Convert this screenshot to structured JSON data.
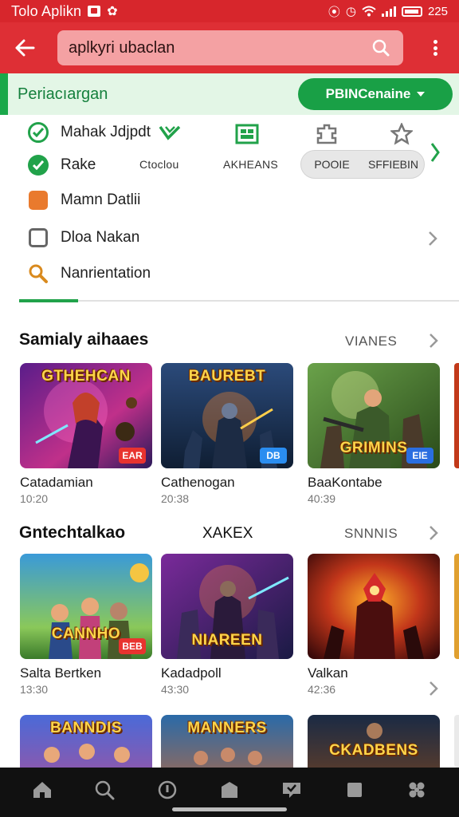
{
  "status_bar": {
    "app_name": "Tolo Aplikn",
    "time": "225"
  },
  "app_bar": {
    "search_value": "aplkyri ubaclan"
  },
  "filter_bar": {
    "title": "Periacıargan",
    "button_label": "PBINCenaine"
  },
  "options": [
    {
      "label": "Mahak Jdjpdt",
      "icon": "check-ring-icon"
    },
    {
      "label": "Rake",
      "icon": "check-circle-icon"
    },
    {
      "label": "Mamn Datlii",
      "icon": "orange-square-icon"
    },
    {
      "label": "Dloa Nakan",
      "icon": "outline-square-icon"
    },
    {
      "label": "Nanrientation",
      "icon": "magnifier-icon"
    }
  ],
  "categories": [
    {
      "label": "Ctoclou",
      "icon": "chevron-check-icon"
    },
    {
      "label": "AKHEANS",
      "icon": "grid-icon"
    },
    {
      "label": "",
      "icon": "puzzle-icon"
    },
    {
      "label": "",
      "icon": "star-icon"
    }
  ],
  "chips": [
    "POOIE",
    "SFFIEBIN"
  ],
  "sections": [
    {
      "title": "Samialy aihaaes",
      "link": "VIANES",
      "middle": "",
      "items": [
        {
          "art_title": "GTHEHCAN",
          "badge": "EAR",
          "badge_color": "#e8332f",
          "name": "Catadamian",
          "time": "10:20"
        },
        {
          "art_title": "BAUREBT",
          "badge": "DB",
          "badge_color": "#2a8df0",
          "name": "Cathenogan",
          "time": "20:38"
        },
        {
          "art_title": "GRIMINS",
          "badge": "EIE",
          "badge_color": "#2a6ee0",
          "name": "BaaKontabe",
          "time": "40:39"
        }
      ]
    },
    {
      "title": "Gntechtalkao",
      "link": "SNNNIS",
      "middle": "XAKEX",
      "items": [
        {
          "art_title": "CANNHO",
          "badge": "BEB",
          "badge_color": "#e8332f",
          "name": "Salta Bertken",
          "time": "13:30"
        },
        {
          "art_title": "NIAREEN",
          "badge": "",
          "badge_color": "",
          "name": "Kadadpoll",
          "time": "43:30"
        },
        {
          "art_title": "",
          "badge": "",
          "badge_color": "",
          "name": "Valkan",
          "time": "42:36"
        }
      ]
    },
    {
      "title": "",
      "link": "",
      "middle": "",
      "items": [
        {
          "art_title": "BANNDIS",
          "badge": "",
          "badge_color": "",
          "name": "",
          "time": ""
        },
        {
          "art_title": "MANNERS",
          "badge": "",
          "badge_color": "",
          "name": "",
          "time": ""
        },
        {
          "art_title": "CKADBENS",
          "badge": "",
          "badge_color": "",
          "name": "",
          "time": ""
        }
      ]
    }
  ],
  "bottom_nav": [
    "home-icon",
    "search-icon",
    "info-icon",
    "library-icon",
    "chat-icon",
    "grid-icon",
    "apps-icon"
  ],
  "colors": {
    "accent_red": "#de2f35",
    "accent_green": "#19a046"
  }
}
